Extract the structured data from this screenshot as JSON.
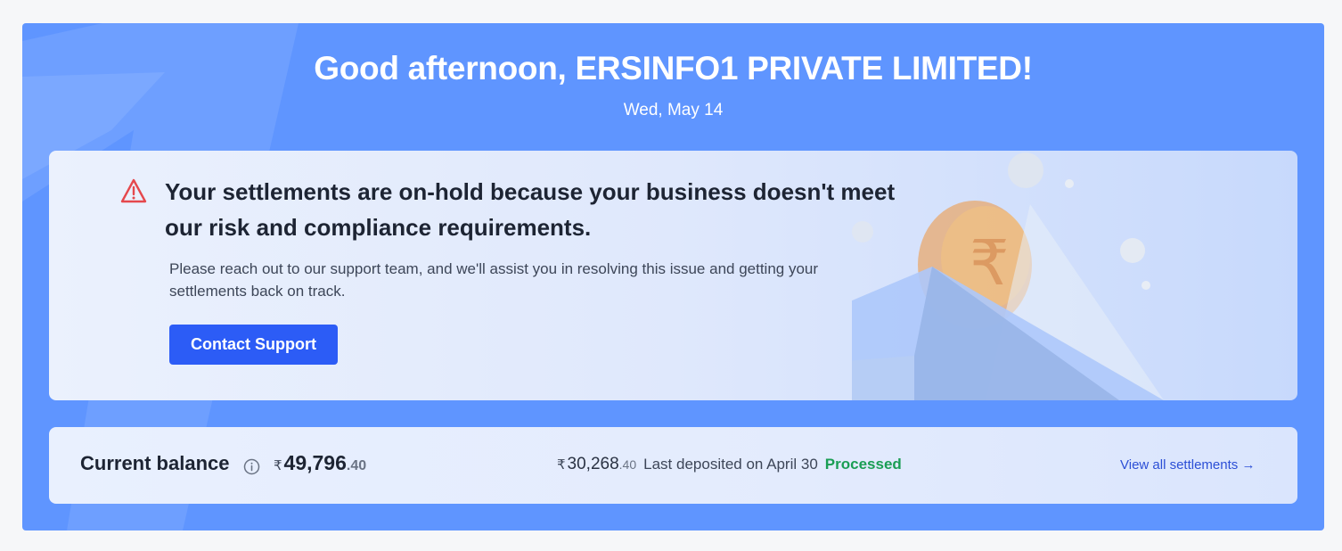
{
  "greeting": "Good afternoon, ERSINFO1 PRIVATE LIMITED!",
  "date": "Wed, May 14",
  "alert": {
    "icon": "warning-triangle-icon",
    "title": "Your settlements are on-hold because your business doesn't meet our risk and compliance requirements.",
    "description": "Please reach out to our support team, and we'll assist you in resolving this issue and getting your settlements back on track.",
    "button_label": "Contact Support"
  },
  "balance": {
    "label": "Current balance",
    "currency_symbol": "₹",
    "amount_main": "49,796",
    "amount_decimal": ".40",
    "last_deposit": {
      "currency_symbol": "₹",
      "amount_main": "30,268",
      "amount_decimal": ".40",
      "text": "Last deposited on April 30",
      "status": "Processed"
    },
    "view_link": "View all settlements →"
  },
  "colors": {
    "panel_bg": "#5f95ff",
    "button": "#2c5cf6",
    "status_processed": "#1a9e54",
    "warning": "#e5484d",
    "link": "#2c4fd6"
  }
}
